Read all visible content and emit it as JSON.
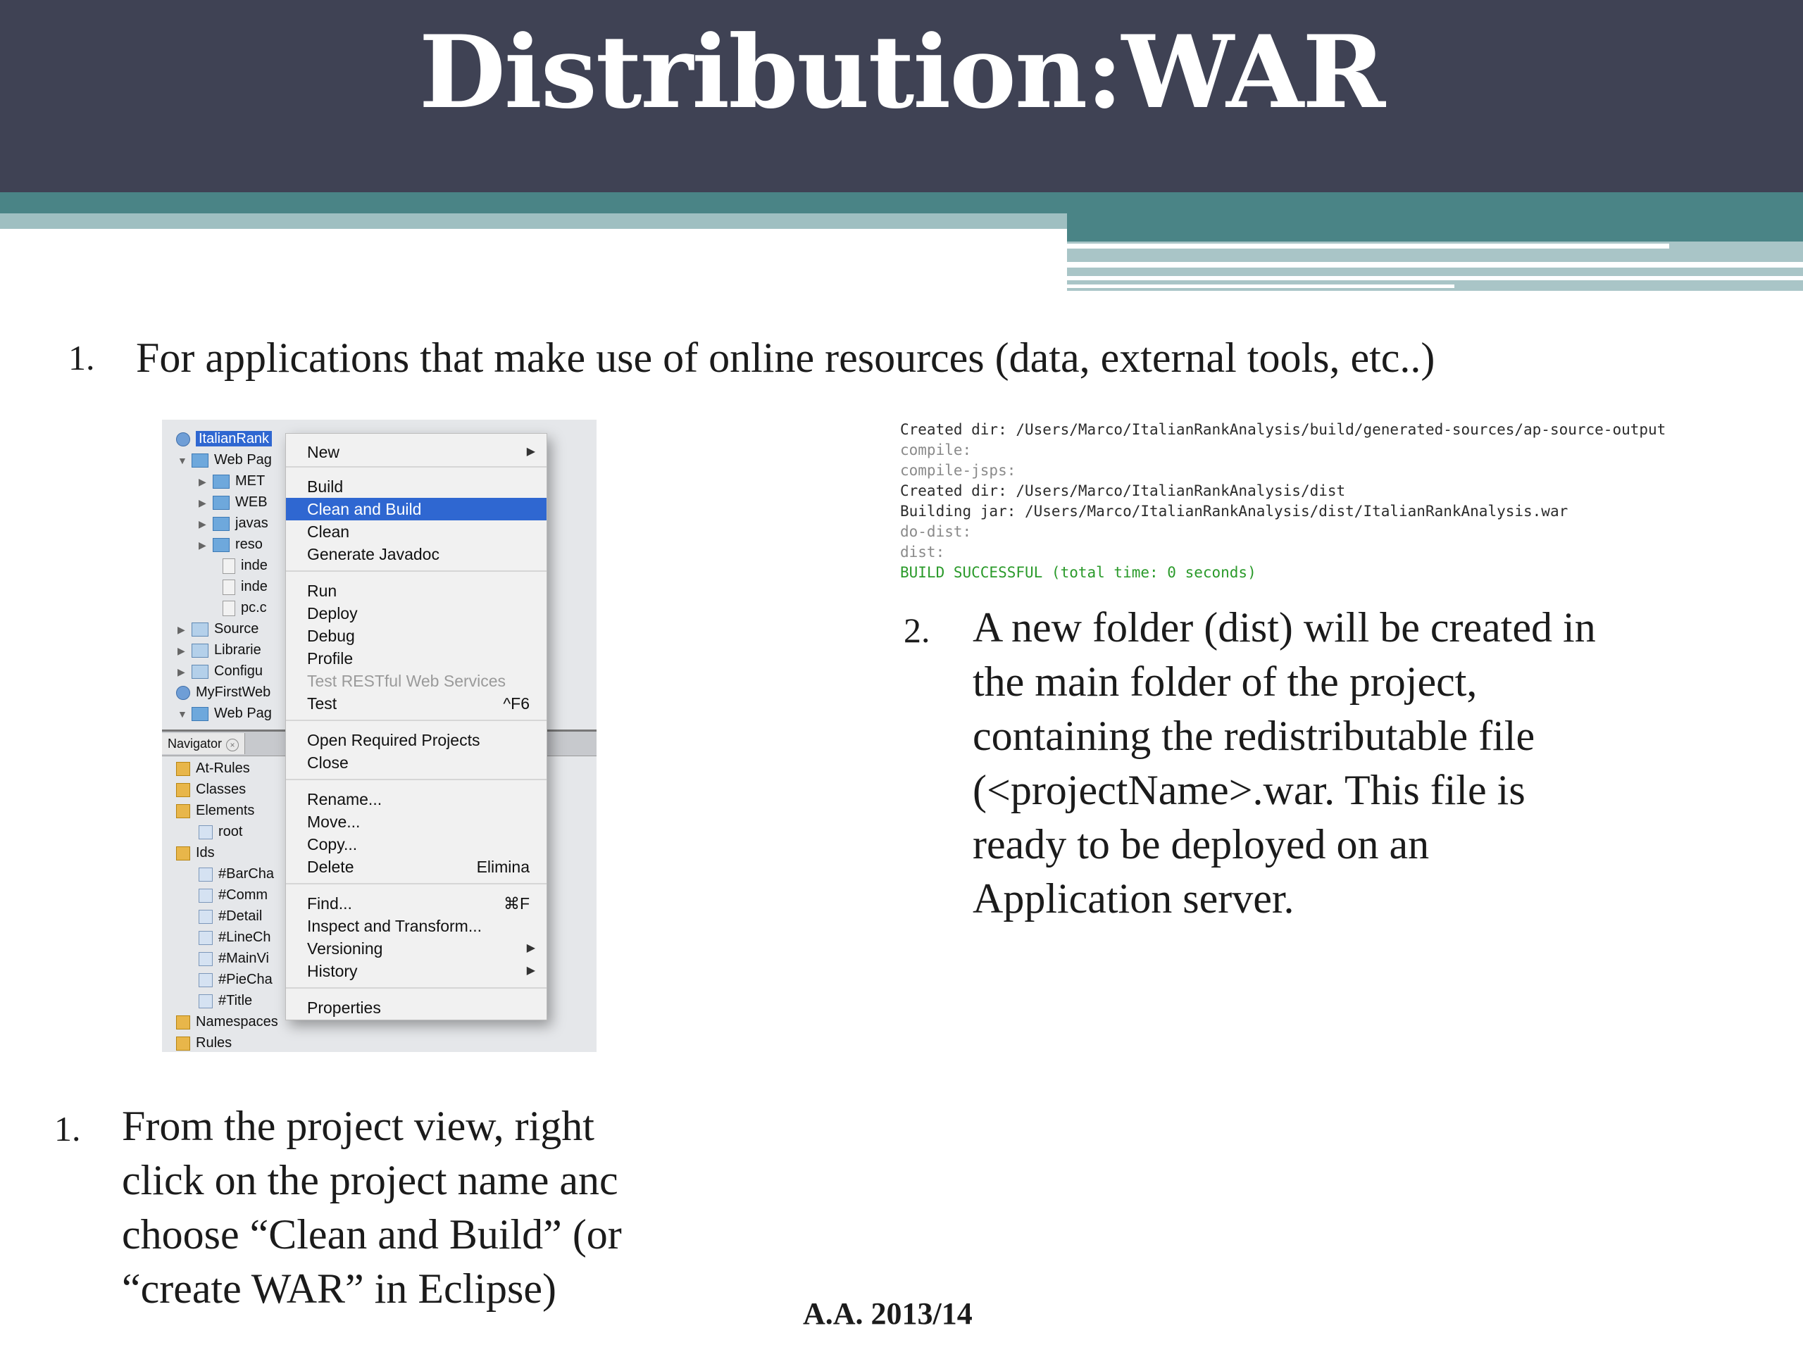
{
  "slide": {
    "title": "Distribution:WAR",
    "footer": "A.A. 2013/14"
  },
  "items": [
    {
      "number": "1.",
      "lines": [
        "For applications that make use of online resources (data, external tools, etc..)"
      ]
    },
    {
      "number": "2.",
      "lines": [
        "A new folder (dist) will be created in",
        "the main folder of the project,",
        "containing the redistributable file",
        "(<projectName>.war. This file is",
        "ready to be deployed on an",
        "Application server."
      ]
    },
    {
      "number": "1.",
      "lines": [
        "From the project view, right",
        "click on the project name anc",
        "choose “Clean and Build” (or",
        "“create WAR” in Eclipse)"
      ]
    }
  ],
  "ide": {
    "tree": [
      {
        "label": "ItalianRank",
        "icon": "globe-icon",
        "expanded": true,
        "selected": true
      },
      {
        "label": "Web Pag",
        "icon": "folder-icon",
        "expanded": true
      },
      {
        "label": "MET",
        "icon": "folder-icon"
      },
      {
        "label": "WEB",
        "icon": "folder-icon"
      },
      {
        "label": "javas",
        "icon": "folder-icon"
      },
      {
        "label": "reso",
        "icon": "folder-icon"
      },
      {
        "label": "inde",
        "icon": "file-icon"
      },
      {
        "label": "inde",
        "icon": "file-icon"
      },
      {
        "label": "pc.c",
        "icon": "file-icon"
      },
      {
        "label": "Source",
        "icon": "package-icon"
      },
      {
        "label": "Librarie",
        "icon": "package-icon"
      },
      {
        "label": "Configu",
        "icon": "package-icon"
      },
      {
        "label": "MyFirstWeb",
        "icon": "globe-icon"
      },
      {
        "label": "Web Pag",
        "icon": "folder-icon"
      }
    ],
    "navigator_tab": "Navigator",
    "navigator": [
      "At-Rules",
      "Classes",
      "Elements",
      "root",
      "Ids",
      "#BarCha",
      "#Comm",
      "#Detail",
      "#LineCh",
      "#MainVi",
      "#PieCha",
      "#Title",
      "Namespaces",
      "Rules"
    ]
  },
  "context_menu": [
    {
      "label": "New",
      "submenu": true
    },
    {
      "label": "Build"
    },
    {
      "label": "Clean and Build",
      "selected": true
    },
    {
      "label": "Clean"
    },
    {
      "label": "Generate Javadoc"
    },
    {
      "label": "Run"
    },
    {
      "label": "Deploy"
    },
    {
      "label": "Debug"
    },
    {
      "label": "Profile"
    },
    {
      "label": "Test RESTful Web Services",
      "disabled": true
    },
    {
      "label": "Test",
      "shortcut": "^F6"
    },
    {
      "label": "Open Required Projects"
    },
    {
      "label": "Close"
    },
    {
      "label": "Rename..."
    },
    {
      "label": "Move..."
    },
    {
      "label": "Copy..."
    },
    {
      "label": "Delete",
      "shortcut": "Elimina"
    },
    {
      "label": "Find...",
      "shortcut": "⌘F"
    },
    {
      "label": "Inspect and Transform..."
    },
    {
      "label": "Versioning",
      "submenu": true
    },
    {
      "label": "History",
      "submenu": true
    },
    {
      "label": "Properties"
    }
  ],
  "console": [
    "Created dir: /Users/Marco/ItalianRankAnalysis/build/generated-sources/ap-source-output",
    "compile:",
    "compile-jsps:",
    "Created dir: /Users/Marco/ItalianRankAnalysis/dist",
    "Building jar: /Users/Marco/ItalianRankAnalysis/dist/ItalianRankAnalysis.war",
    "do-dist:",
    "dist:",
    "BUILD SUCCESSFUL (total time: 0 seconds)"
  ]
}
